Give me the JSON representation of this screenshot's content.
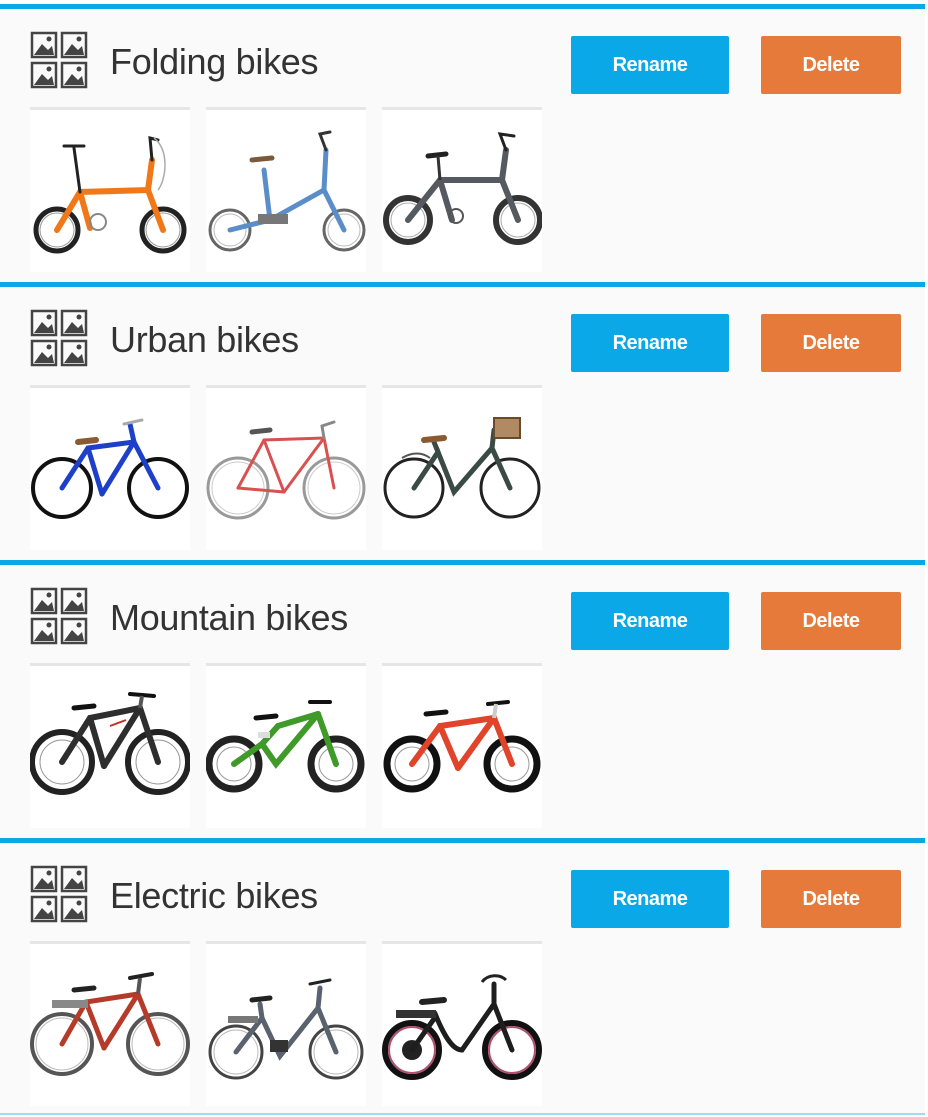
{
  "categories": [
    {
      "title": "Folding bikes",
      "rename_label": "Rename",
      "delete_label": "Delete",
      "bikes": [
        {
          "icon": "folding-bike-orange-icon",
          "frame_color": "#f07818"
        },
        {
          "icon": "folding-bike-blue-icon",
          "frame_color": "#5b8ec8"
        },
        {
          "icon": "folding-bike-gray-icon",
          "frame_color": "#555a60"
        }
      ]
    },
    {
      "title": "Urban bikes",
      "rename_label": "Rename",
      "delete_label": "Delete",
      "bikes": [
        {
          "icon": "urban-bike-blue-icon",
          "frame_color": "#1e3fc8"
        },
        {
          "icon": "urban-bike-red-icon",
          "frame_color": "#d85050"
        },
        {
          "icon": "urban-bike-green-icon",
          "frame_color": "#3a4a44"
        }
      ]
    },
    {
      "title": "Mountain bikes",
      "rename_label": "Rename",
      "delete_label": "Delete",
      "bikes": [
        {
          "icon": "mountain-bike-black-icon",
          "frame_color": "#2e2e2e"
        },
        {
          "icon": "mountain-bike-green-icon",
          "frame_color": "#3f9a2a"
        },
        {
          "icon": "mountain-bike-red-icon",
          "frame_color": "#e0442a"
        }
      ]
    },
    {
      "title": "Electric bikes",
      "rename_label": "Rename",
      "delete_label": "Delete",
      "bikes": [
        {
          "icon": "electric-bike-red-icon",
          "frame_color": "#b43a2a"
        },
        {
          "icon": "electric-bike-gray-icon",
          "frame_color": "#5a6270"
        },
        {
          "icon": "electric-bike-black-icon",
          "frame_color": "#1e1e1e"
        }
      ]
    }
  ],
  "colors": {
    "accent_blue": "#0aa8e6",
    "delete_orange": "#e57a3a",
    "title_text": "#333333",
    "panel_bg": "#fafafa"
  }
}
